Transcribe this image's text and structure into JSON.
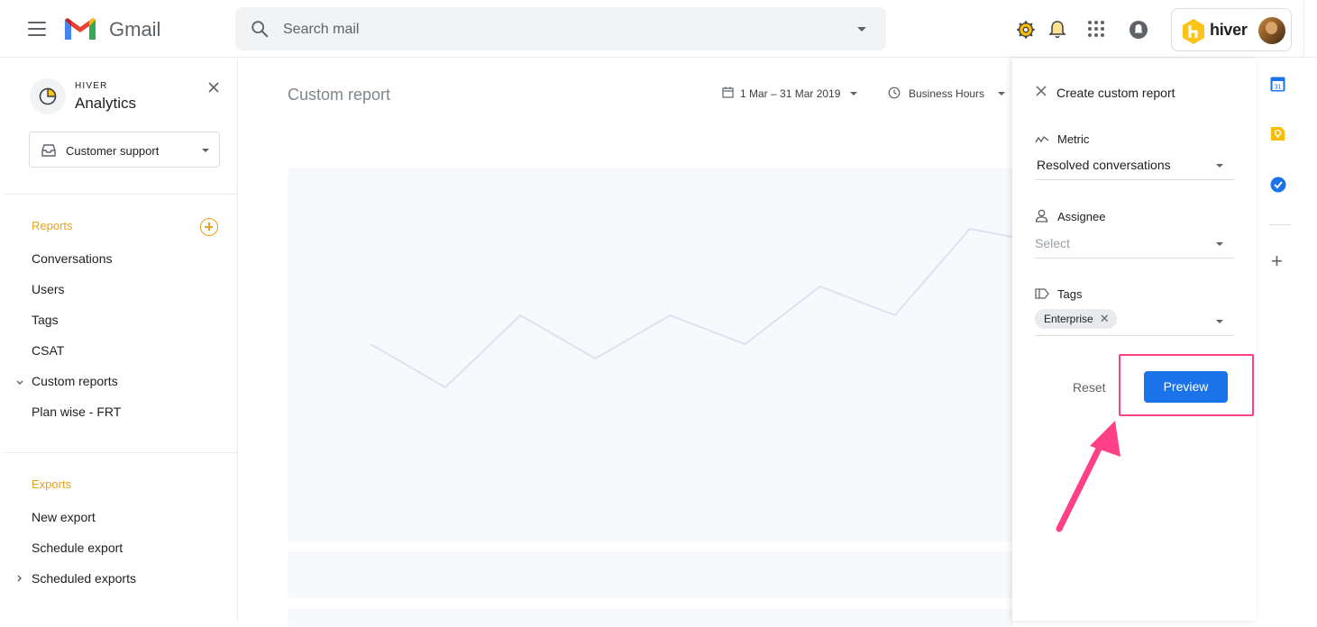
{
  "app": {
    "name": "Gmail",
    "search_placeholder": "Search mail"
  },
  "hiver": {
    "label": "hiver"
  },
  "sidebar": {
    "brand_small": "HIVER",
    "brand_big": "Analytics",
    "inbox_select": "Customer support",
    "reports_title": "Reports",
    "reports": [
      "Conversations",
      "Users",
      "Tags",
      "CSAT",
      "Custom reports",
      "Plan wise - FRT"
    ],
    "exports_title": "Exports",
    "exports": [
      "New export",
      "Schedule export",
      "Scheduled exports"
    ]
  },
  "main": {
    "title": "Custom report",
    "date_range": "1 Mar – 31 Mar 2019",
    "hours": "Business Hours"
  },
  "chart_data": {
    "type": "line",
    "x": [
      1,
      2,
      3,
      4,
      5,
      6,
      7,
      8,
      9,
      10
    ],
    "values": [
      4,
      1,
      6,
      3,
      6,
      4,
      8,
      6,
      12,
      11
    ],
    "ylim": [
      0,
      20
    ],
    "grid": false,
    "colors": [
      "#dde2f0"
    ]
  },
  "panel": {
    "title": "Create custom report",
    "metric_label": "Metric",
    "metric_value": "Resolved conversations",
    "assignee_label": "Assignee",
    "assignee_placeholder": "Select",
    "tags_label": "Tags",
    "tag_chip": "Enterprise",
    "reset_label": "Reset",
    "preview_label": "Preview"
  },
  "colors": {
    "accent": "#e8a21c",
    "primary": "#1a73e8",
    "highlight": "#ff3f86"
  }
}
